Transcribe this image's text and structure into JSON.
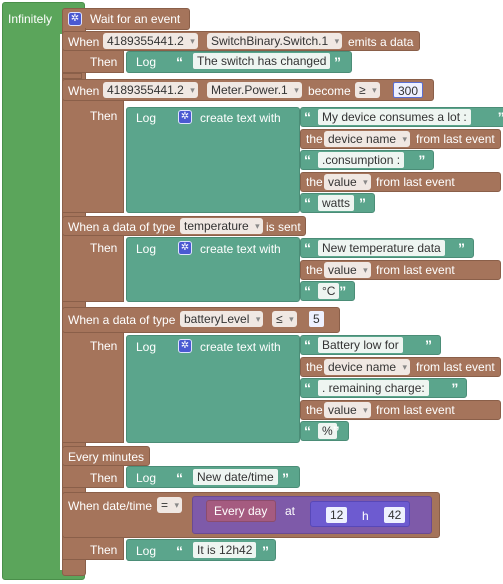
{
  "loop": {
    "label": "Infinitely"
  },
  "wait": {
    "label": "Wait for an event"
  },
  "when1": {
    "when": "When",
    "device": "4189355441.2",
    "source": "SwitchBinary.Switch.1",
    "emits": "emits a data",
    "then": "Then",
    "log": "Log",
    "text": "The switch has changed"
  },
  "when2": {
    "when": "When",
    "device": "4189355441.2",
    "source": "Meter.Power.1",
    "become": "become",
    "op": "≥",
    "value": "300",
    "then": "Then",
    "log": "Log",
    "create": "create text with",
    "items": [
      {
        "type": "text",
        "text": "My device consumes a lot :"
      },
      {
        "type": "field",
        "the": "the",
        "field": "device name",
        "tail": "from last event"
      },
      {
        "type": "text",
        "text": ".consumption :"
      },
      {
        "type": "field",
        "the": "the",
        "field": "value",
        "tail": "from last event"
      },
      {
        "type": "text",
        "text": "watts"
      }
    ]
  },
  "when3": {
    "when": "When a data of type",
    "dtype": "temperature",
    "sent": "is sent",
    "then": "Then",
    "log": "Log",
    "create": "create text with",
    "items": [
      {
        "type": "text",
        "text": "New temperature data"
      },
      {
        "type": "field",
        "the": "the",
        "field": "value",
        "tail": "from last event"
      },
      {
        "type": "text",
        "text": "°C"
      }
    ]
  },
  "when4": {
    "when": "When a data of type",
    "dtype": "batteryLevel",
    "op": "≤",
    "value": "5",
    "then": "Then",
    "log": "Log",
    "create": "create text with",
    "items": [
      {
        "type": "text",
        "text": "Battery low for"
      },
      {
        "type": "field",
        "the": "the",
        "field": "device name",
        "tail": "from last event"
      },
      {
        "type": "text",
        "text": ". remaining charge:"
      },
      {
        "type": "field",
        "the": "the",
        "field": "value",
        "tail": "from last event"
      },
      {
        "type": "text",
        "text": "%"
      }
    ]
  },
  "every": {
    "label": "Every minutes",
    "then": "Then",
    "log": "Log",
    "text": "New date/time"
  },
  "datetime": {
    "when": "When date/time",
    "op": "=",
    "freq": "Every day",
    "at": "at",
    "hour": "12",
    "h": "h",
    "minute": "42",
    "then": "Then",
    "log": "Log",
    "text": "It is 12h42"
  }
}
